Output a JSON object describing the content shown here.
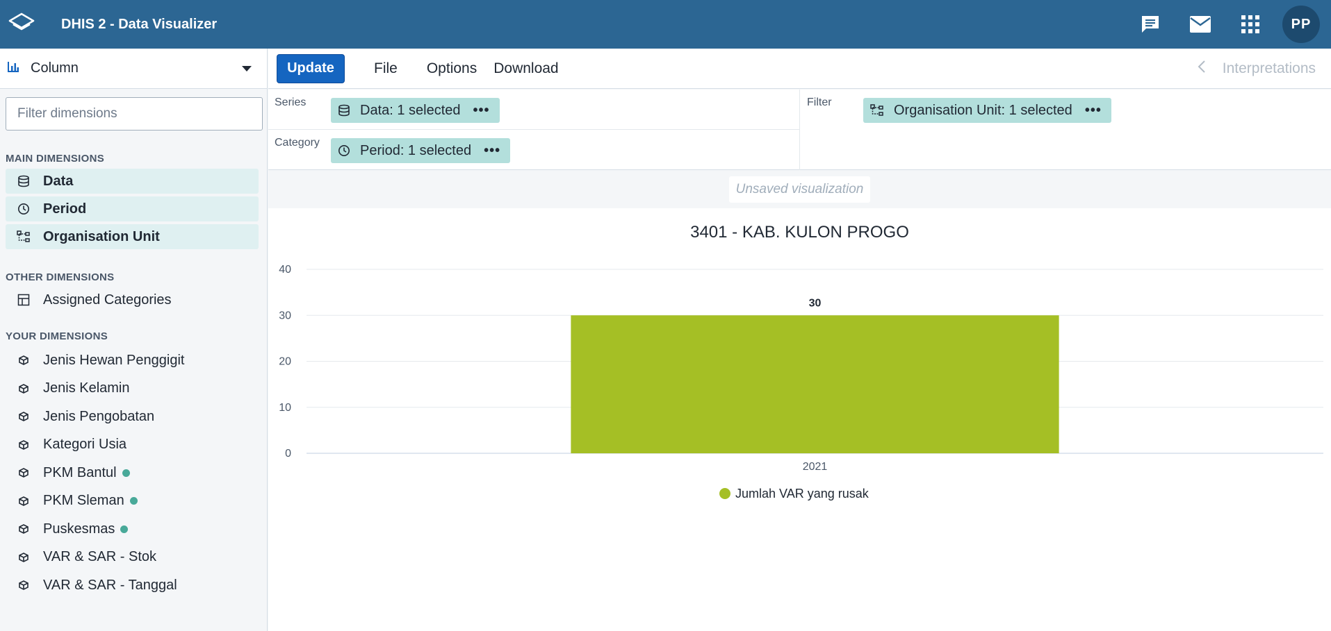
{
  "header": {
    "app_title": "DHIS 2 - Data Visualizer",
    "avatar_initials": "PP",
    "icons": [
      "interpretations-icon",
      "mail-icon",
      "apps-icon"
    ]
  },
  "left_panel": {
    "vis_type": "Column",
    "filter_placeholder": "Filter dimensions",
    "main_title": "MAIN DIMENSIONS",
    "main_items": [
      "Data",
      "Period",
      "Organisation Unit"
    ],
    "other_title": "OTHER DIMENSIONS",
    "other_items": [
      "Assigned Categories"
    ],
    "your_title": "YOUR DIMENSIONS",
    "your_items": [
      {
        "label": "Jenis Hewan Penggigit",
        "dot": false
      },
      {
        "label": "Jenis Kelamin",
        "dot": false
      },
      {
        "label": "Jenis Pengobatan",
        "dot": false
      },
      {
        "label": "Kategori Usia",
        "dot": false
      },
      {
        "label": "PKM Bantul",
        "dot": true
      },
      {
        "label": "PKM Sleman",
        "dot": true
      },
      {
        "label": "Puskesmas",
        "dot": true
      },
      {
        "label": "VAR & SAR - Stok",
        "dot": false
      },
      {
        "label": "VAR & SAR - Tanggal",
        "dot": false
      }
    ],
    "dot_color": "#48a999"
  },
  "menubar": {
    "update": "Update",
    "file": "File",
    "options": "Options",
    "download": "Download",
    "interpretations": "Interpretations"
  },
  "layout": {
    "series_label": "Series",
    "series_chip": "Data: 1 selected",
    "category_label": "Category",
    "category_chip": "Period: 1 selected",
    "filter_label": "Filter",
    "filter_chip": "Organisation Unit: 1 selected"
  },
  "vis": {
    "status": "Unsaved visualization"
  },
  "colors": {
    "header": "#2c6693",
    "update_button": "#1565c0",
    "chip": "#b3dfdc",
    "bar": "#a5bf25"
  },
  "chart_data": {
    "type": "bar",
    "title": "3401 - KAB. KULON PROGO",
    "categories": [
      "2021"
    ],
    "series": [
      {
        "name": "Jumlah VAR yang rusak",
        "values": [
          30
        ],
        "color": "#a5bf25"
      }
    ],
    "data_labels": [
      "30"
    ],
    "ylim": [
      0,
      40
    ],
    "yticks": [
      0,
      10,
      20,
      30,
      40
    ],
    "grid": true,
    "legend": "bottom-center"
  }
}
